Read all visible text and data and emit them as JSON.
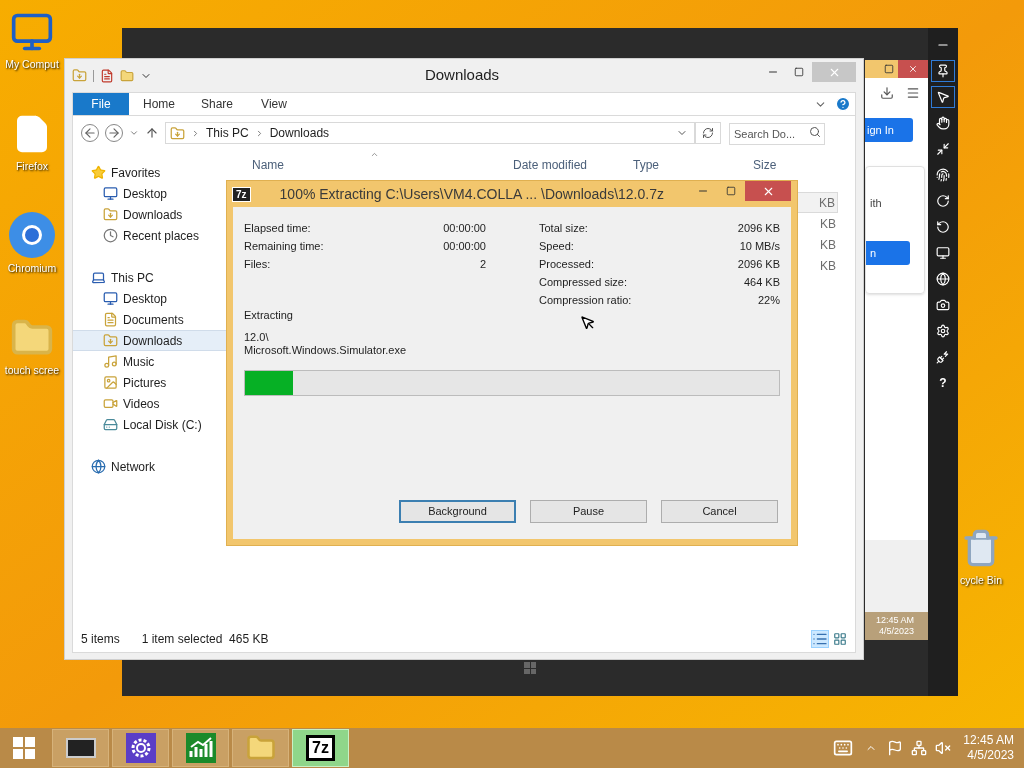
{
  "desktop_icons": [
    {
      "label": "My Comput",
      "kind": "computer"
    },
    {
      "label": "Firefox",
      "kind": "file"
    },
    {
      "label": "Chromium",
      "kind": "chromium"
    },
    {
      "label": "touch scree",
      "kind": "folder"
    },
    {
      "label": "cycle Bin",
      "kind": "bin"
    }
  ],
  "simulator": {
    "toolbar": [
      {
        "kind": "minimize",
        "selected": false
      },
      {
        "kind": "pin",
        "selected": true
      },
      {
        "kind": "pointer",
        "selected": true
      },
      {
        "kind": "hand",
        "selected": false
      },
      {
        "kind": "pinch",
        "selected": false
      },
      {
        "kind": "rotate-touch",
        "selected": false
      },
      {
        "kind": "rotate-cw",
        "selected": false
      },
      {
        "kind": "rotate-ccw",
        "selected": false
      },
      {
        "kind": "monitor",
        "selected": false
      },
      {
        "kind": "globe",
        "selected": false
      },
      {
        "kind": "camera",
        "selected": false
      },
      {
        "kind": "settings",
        "selected": false
      },
      {
        "kind": "network",
        "selected": false
      },
      {
        "kind": "help",
        "selected": false,
        "label": "?"
      }
    ],
    "screen": {
      "sign_in": "ign In",
      "text": "ith",
      "button": "n",
      "time": "12:45 AM",
      "date": "4/5/2023"
    }
  },
  "explorer": {
    "title": "Downloads",
    "ribbon_tabs": [
      {
        "label": "File",
        "selected": true
      },
      {
        "label": "Home",
        "selected": false
      },
      {
        "label": "Share",
        "selected": false
      },
      {
        "label": "View",
        "selected": false
      }
    ],
    "breadcrumb": [
      "This PC",
      "Downloads"
    ],
    "search": {
      "placeholder": "Search Do..."
    },
    "nav": [
      {
        "label": "Favorites",
        "kind": "star",
        "selected": false,
        "children": [
          {
            "label": "Desktop",
            "kind": "desktop",
            "selected": false
          },
          {
            "label": "Downloads",
            "kind": "downloads",
            "selected": false
          },
          {
            "label": "Recent places",
            "kind": "recent",
            "selected": false
          }
        ]
      },
      {
        "label": "This PC",
        "kind": "pc",
        "selected": false,
        "children": [
          {
            "label": "Desktop",
            "kind": "desktop",
            "selected": false
          },
          {
            "label": "Documents",
            "kind": "documents",
            "selected": false
          },
          {
            "label": "Downloads",
            "kind": "downloads",
            "selected": true
          },
          {
            "label": "Music",
            "kind": "music",
            "selected": false
          },
          {
            "label": "Pictures",
            "kind": "pictures",
            "selected": false
          },
          {
            "label": "Videos",
            "kind": "videos",
            "selected": false
          },
          {
            "label": "Local Disk (C:)",
            "kind": "disk",
            "selected": false
          }
        ]
      },
      {
        "label": "Network",
        "kind": "network",
        "selected": false
      }
    ],
    "columns": [
      "Name",
      "Date modified",
      "Type",
      "Size"
    ],
    "rows": [
      {
        "size": "KB",
        "selected": true
      },
      {
        "size": "KB",
        "selected": false
      },
      {
        "size": "KB",
        "selected": false
      },
      {
        "size": "KB",
        "selected": false
      }
    ],
    "status": {
      "count": "5 items",
      "selection": "1 item selected  465 KB"
    }
  },
  "extract_dialog": {
    "icon_label": "7z",
    "title": "100% Extracting C:\\Users\\VM4.COLLA ... \\Downloads\\12.0.7z",
    "left_stats": [
      {
        "label": "Elapsed time:",
        "value": "00:00:00"
      },
      {
        "label": "Remaining time:",
        "value": "00:00:00"
      },
      {
        "label": "Files:",
        "value": "2"
      }
    ],
    "right_stats": [
      {
        "label": "Total size:",
        "value": "2096 KB"
      },
      {
        "label": "Speed:",
        "value": "10 MB/s"
      },
      {
        "label": "Processed:",
        "value": "2096 KB"
      },
      {
        "label": "Compressed size:",
        "value": "464 KB"
      },
      {
        "label": "Compression ratio:",
        "value": "22%"
      }
    ],
    "status_label": "Extracting",
    "current_path": "12.0\\",
    "current_file": "Microsoft.Windows.Simulator.exe",
    "progress": {
      "level": 0.09
    },
    "buttons": [
      {
        "label": "Background",
        "focused": true
      },
      {
        "label": "Pause",
        "focused": false
      },
      {
        "label": "Cancel",
        "focused": false
      }
    ]
  },
  "taskbar": {
    "apps": [
      {
        "kind": "monitor",
        "active": false
      },
      {
        "kind": "settings",
        "active": false
      },
      {
        "kind": "chart",
        "active": false
      },
      {
        "kind": "explorer",
        "active": false
      },
      {
        "kind": "sevenzip",
        "active": true,
        "label": "7z"
      }
    ],
    "time": "12:45 AM",
    "date": "4/5/2023"
  }
}
